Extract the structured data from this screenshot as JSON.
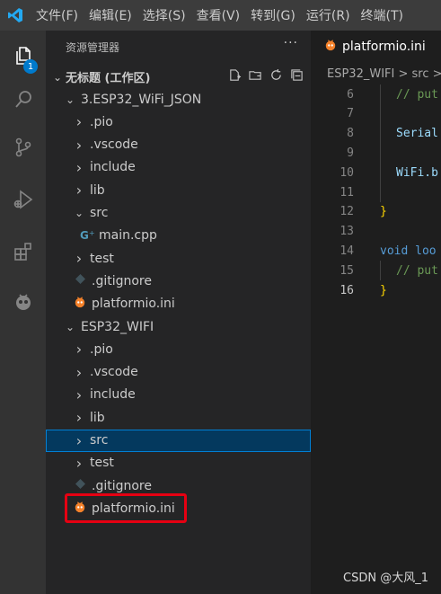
{
  "menubar": {
    "items": [
      "文件(F)",
      "编辑(E)",
      "选择(S)",
      "查看(V)",
      "转到(G)",
      "运行(R)",
      "终端(T)"
    ]
  },
  "activity_bar": {
    "icons": [
      "explorer-icon",
      "search-icon",
      "source-control-icon",
      "run-debug-icon",
      "extensions-icon",
      "platformio-icon"
    ],
    "explorer_badge": "1"
  },
  "sidebar": {
    "title": "资源管理器",
    "more": "···",
    "workspace": "无标题 (工作区)",
    "rows": [
      {
        "label": "3.ESP32_WiFi_JSON",
        "kind": "folder-open",
        "indent": 1
      },
      {
        "label": ".pio",
        "kind": "folder",
        "indent": 2
      },
      {
        "label": ".vscode",
        "kind": "folder",
        "indent": 2
      },
      {
        "label": "include",
        "kind": "folder",
        "indent": 2
      },
      {
        "label": "lib",
        "kind": "folder",
        "indent": 2
      },
      {
        "label": "src",
        "kind": "folder-open",
        "indent": 2
      },
      {
        "label": "main.cpp",
        "kind": "cpp",
        "indent": 3
      },
      {
        "label": "test",
        "kind": "folder",
        "indent": 2
      },
      {
        "label": ".gitignore",
        "kind": "gitignore",
        "indent": 2
      },
      {
        "label": "platformio.ini",
        "kind": "pio",
        "indent": 2
      },
      {
        "label": "ESP32_WIFI",
        "kind": "folder-open",
        "indent": 1
      },
      {
        "label": ".pio",
        "kind": "folder",
        "indent": 2
      },
      {
        "label": ".vscode",
        "kind": "folder",
        "indent": 2
      },
      {
        "label": "include",
        "kind": "folder",
        "indent": 2
      },
      {
        "label": "lib",
        "kind": "folder",
        "indent": 2
      },
      {
        "label": "src",
        "kind": "folder",
        "indent": 2,
        "selected": true
      },
      {
        "label": "test",
        "kind": "folder",
        "indent": 2
      },
      {
        "label": ".gitignore",
        "kind": "gitignore",
        "indent": 2
      },
      {
        "label": "platformio.ini",
        "kind": "pio",
        "indent": 2
      }
    ]
  },
  "editor": {
    "tab_label": "platformio.ini",
    "breadcrumb": "ESP32_WIFI > src >",
    "lines": [
      {
        "n": "6",
        "text": "// put",
        "cls": "c-comment",
        "indent": 1
      },
      {
        "n": "7",
        "text": "",
        "cls": "",
        "indent": 1
      },
      {
        "n": "8",
        "text": "Serial",
        "cls": "c-var",
        "indent": 1
      },
      {
        "n": "9",
        "text": "",
        "cls": "",
        "indent": 1
      },
      {
        "n": "10",
        "text": "WiFi.b",
        "cls": "c-var",
        "indent": 1
      },
      {
        "n": "11",
        "text": "",
        "cls": "",
        "indent": 1
      },
      {
        "n": "12",
        "text": "}",
        "cls": "c-brace",
        "indent": 0
      },
      {
        "n": "13",
        "text": "",
        "cls": "",
        "indent": 0
      },
      {
        "n": "14",
        "text": "void loo",
        "cls": "c-kw",
        "indent": 0
      },
      {
        "n": "15",
        "text": "// put",
        "cls": "c-comment",
        "indent": 1
      },
      {
        "n": "16",
        "text": "}",
        "cls": "c-brace",
        "indent": 0,
        "current": true
      }
    ]
  },
  "watermark": "CSDN @大风_1"
}
